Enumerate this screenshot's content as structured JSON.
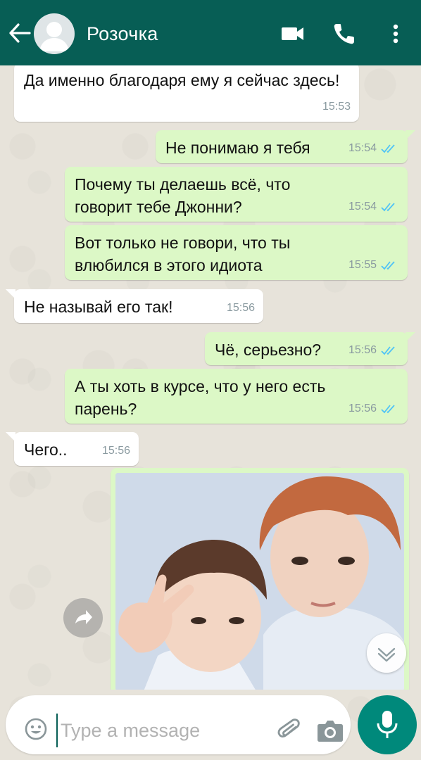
{
  "header": {
    "contact_name": "Розочка",
    "icons": [
      "back-arrow-icon",
      "avatar-placeholder",
      "video-call-icon",
      "phone-icon",
      "more-vert-icon"
    ],
    "background_color": "#075e55"
  },
  "messages": [
    {
      "direction": "in",
      "text": "Да именно благодаря ему я сейчас здесь!",
      "time": "15:53"
    },
    {
      "direction": "out",
      "text": "Не понимаю я тебя",
      "time": "15:54",
      "status": "read"
    },
    {
      "direction": "out",
      "text": "Почему ты делаешь всё, что говорит тебе Джонни?",
      "time": "15:54",
      "status": "read"
    },
    {
      "direction": "out",
      "text": "Вот только не говори, что ты влюбился в этого идиота",
      "time": "15:55",
      "status": "read"
    },
    {
      "direction": "in",
      "text": "Не называй его так!",
      "time": "15:56"
    },
    {
      "direction": "out",
      "text": "Чё, серьезно?",
      "time": "15:56",
      "status": "read"
    },
    {
      "direction": "out",
      "text": "А ты хоть в курсе, что у него есть парень?",
      "time": "15:56",
      "status": "read"
    },
    {
      "direction": "in",
      "text": "Чего..",
      "time": "15:56"
    },
    {
      "direction": "out",
      "type": "image",
      "icons": [
        "forward-icon",
        "scroll-down-icon"
      ]
    }
  ],
  "input": {
    "placeholder": "Type a message",
    "icons": [
      "emoji-icon",
      "attach-icon",
      "camera-icon",
      "mic-icon"
    ]
  },
  "colors": {
    "incoming_bubble": "#ffffff",
    "outgoing_bubble": "#dcf8c6",
    "read_ticks": "#4fc3f7",
    "mic_button": "#00897b"
  }
}
